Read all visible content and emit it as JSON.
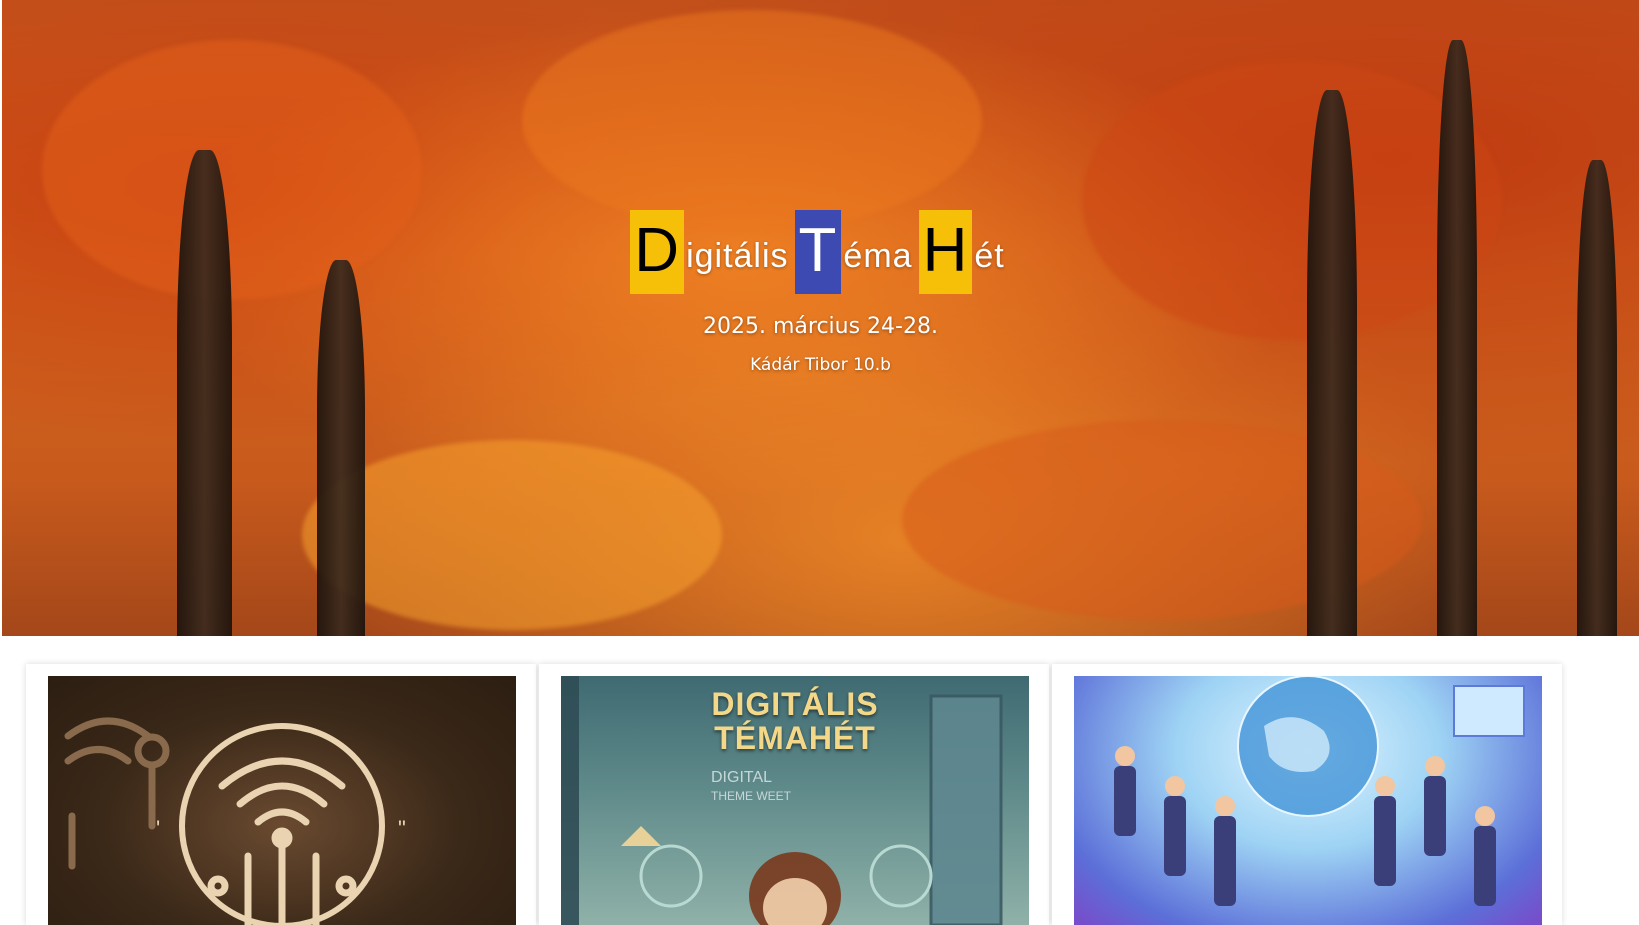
{
  "hero": {
    "title": {
      "word1_cap": "D",
      "word1_rest": "igitális",
      "word2_cap": "T",
      "word2_rest": "éma",
      "word3_cap": "H",
      "word3_rest": "ét"
    },
    "date": "2025. március 24-28.",
    "author": "Kádár Tibor 10.b"
  },
  "cards": [
    {
      "image_icon": "circuit-wifi-logo"
    },
    {
      "image_text_line1": "DIGITÁLIS",
      "image_text_line2": "TÉMAHÉT",
      "image_subtext_line1": "DIGITAL",
      "image_subtext_line2": "THEME WEET"
    },
    {
      "image_icon": "students-globe-illustration"
    }
  ],
  "colors": {
    "accent_yellow": "#f7c008",
    "accent_blue": "#3d4ab1"
  }
}
